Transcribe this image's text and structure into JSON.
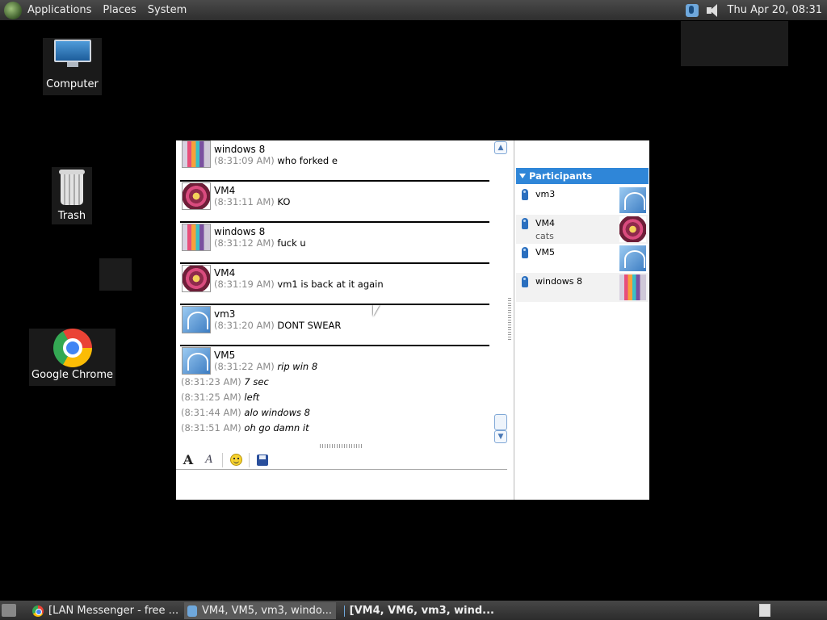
{
  "top_panel": {
    "menus": [
      "Applications",
      "Places",
      "System"
    ],
    "clock": "Thu Apr 20, 08:31"
  },
  "desktop": {
    "icons": [
      {
        "label": "Computer",
        "icon": "computer-icon"
      },
      {
        "label": "Trash",
        "icon": "trash-icon"
      },
      {
        "label": "Google Chrome",
        "icon": "chrome-icon"
      }
    ]
  },
  "chat": {
    "messages": [
      {
        "sender": "windows 8",
        "avatar": "windows8",
        "lines": [
          {
            "time": "(8:31:09 AM)",
            "text": "who forked e"
          }
        ]
      },
      {
        "sender": "VM4",
        "avatar": "vm4",
        "lines": [
          {
            "time": "(8:31:11 AM)",
            "text": "KO"
          }
        ]
      },
      {
        "sender": "windows 8",
        "avatar": "windows8",
        "lines": [
          {
            "time": "(8:31:12 AM)",
            "text": "fuck u"
          }
        ]
      },
      {
        "sender": "VM4",
        "avatar": "vm4",
        "lines": [
          {
            "time": "(8:31:19 AM)",
            "text": "vm1 is back at it again"
          }
        ]
      },
      {
        "sender": "vm3",
        "avatar": "vm3",
        "lines": [
          {
            "time": "(8:31:20 AM)",
            "text": "DONT SWEAR"
          }
        ]
      },
      {
        "sender": "VM5",
        "avatar": "vm3",
        "lines": [
          {
            "time": "(8:31:22 AM)",
            "text": "rip win 8"
          },
          {
            "time": "(8:31:23 AM)",
            "text": "7 sec"
          },
          {
            "time": "(8:31:25 AM)",
            "text": "left"
          },
          {
            "time": "(8:31:44 AM)",
            "text": "alo windows 8"
          },
          {
            "time": "(8:31:51 AM)",
            "text": "oh go damn it"
          }
        ]
      }
    ]
  },
  "participants": {
    "header": "Participants",
    "list": [
      {
        "name": "vm3",
        "note": ""
      },
      {
        "name": "VM4",
        "note": "cats"
      },
      {
        "name": "VM5",
        "note": ""
      },
      {
        "name": "windows 8",
        "note": ""
      }
    ]
  },
  "taskbar": {
    "items": [
      {
        "label": "[LAN Messenger - free ...",
        "icon": "chrome-icon"
      },
      {
        "label": "VM4, VM5, vm3, windo...",
        "icon": "lan-messenger-icon"
      },
      {
        "label": "[VM4, VM6, vm3, wind...",
        "icon": "lan-messenger-icon"
      }
    ]
  }
}
